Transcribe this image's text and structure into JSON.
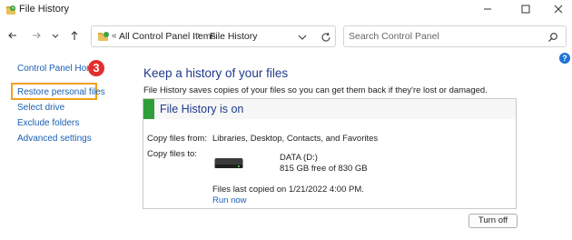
{
  "window": {
    "title": "File History"
  },
  "address_bar": {
    "overflow_glyph": "«",
    "crumbs": [
      "All Control Panel Items",
      "File History"
    ],
    "separator": "›"
  },
  "search": {
    "placeholder": "Search Control Panel"
  },
  "help": {
    "glyph": "?"
  },
  "sidebar": {
    "items": [
      {
        "label": "Control Panel Home"
      },
      {
        "label": "Restore personal files",
        "highlighted": true
      },
      {
        "label": "Select drive"
      },
      {
        "label": "Exclude folders"
      },
      {
        "label": "Advanced settings"
      }
    ]
  },
  "annotation": {
    "step_number": "3",
    "badge_color": "#e42d2d",
    "highlight_color": "#f0a11a"
  },
  "main": {
    "title": "Keep a history of your files",
    "description": "File History saves copies of your files so you can get them back if they're lost or damaged.",
    "status": {
      "text": "File History is on",
      "color": "#2f9e3a"
    },
    "copy_from": {
      "label": "Copy files from:",
      "value": "Libraries, Desktop, Contacts, and Favorites"
    },
    "copy_to": {
      "label": "Copy files to:",
      "drive_name": "DATA (D:)",
      "drive_space": "815 GB free of 830 GB"
    },
    "last_copied": "Files last copied on 1/21/2022 4:00 PM.",
    "run_now": "Run now",
    "turn_off": "Turn off"
  },
  "icons": {
    "app": "file-history-icon",
    "minimize": "minimize-icon",
    "maximize": "maximize-icon",
    "close": "close-icon",
    "back": "back-arrow-icon",
    "forward": "forward-arrow-icon",
    "recent": "chevron-down-icon",
    "up": "up-arrow-icon",
    "refresh": "refresh-icon",
    "search": "search-icon",
    "drive": "hard-drive-icon"
  }
}
